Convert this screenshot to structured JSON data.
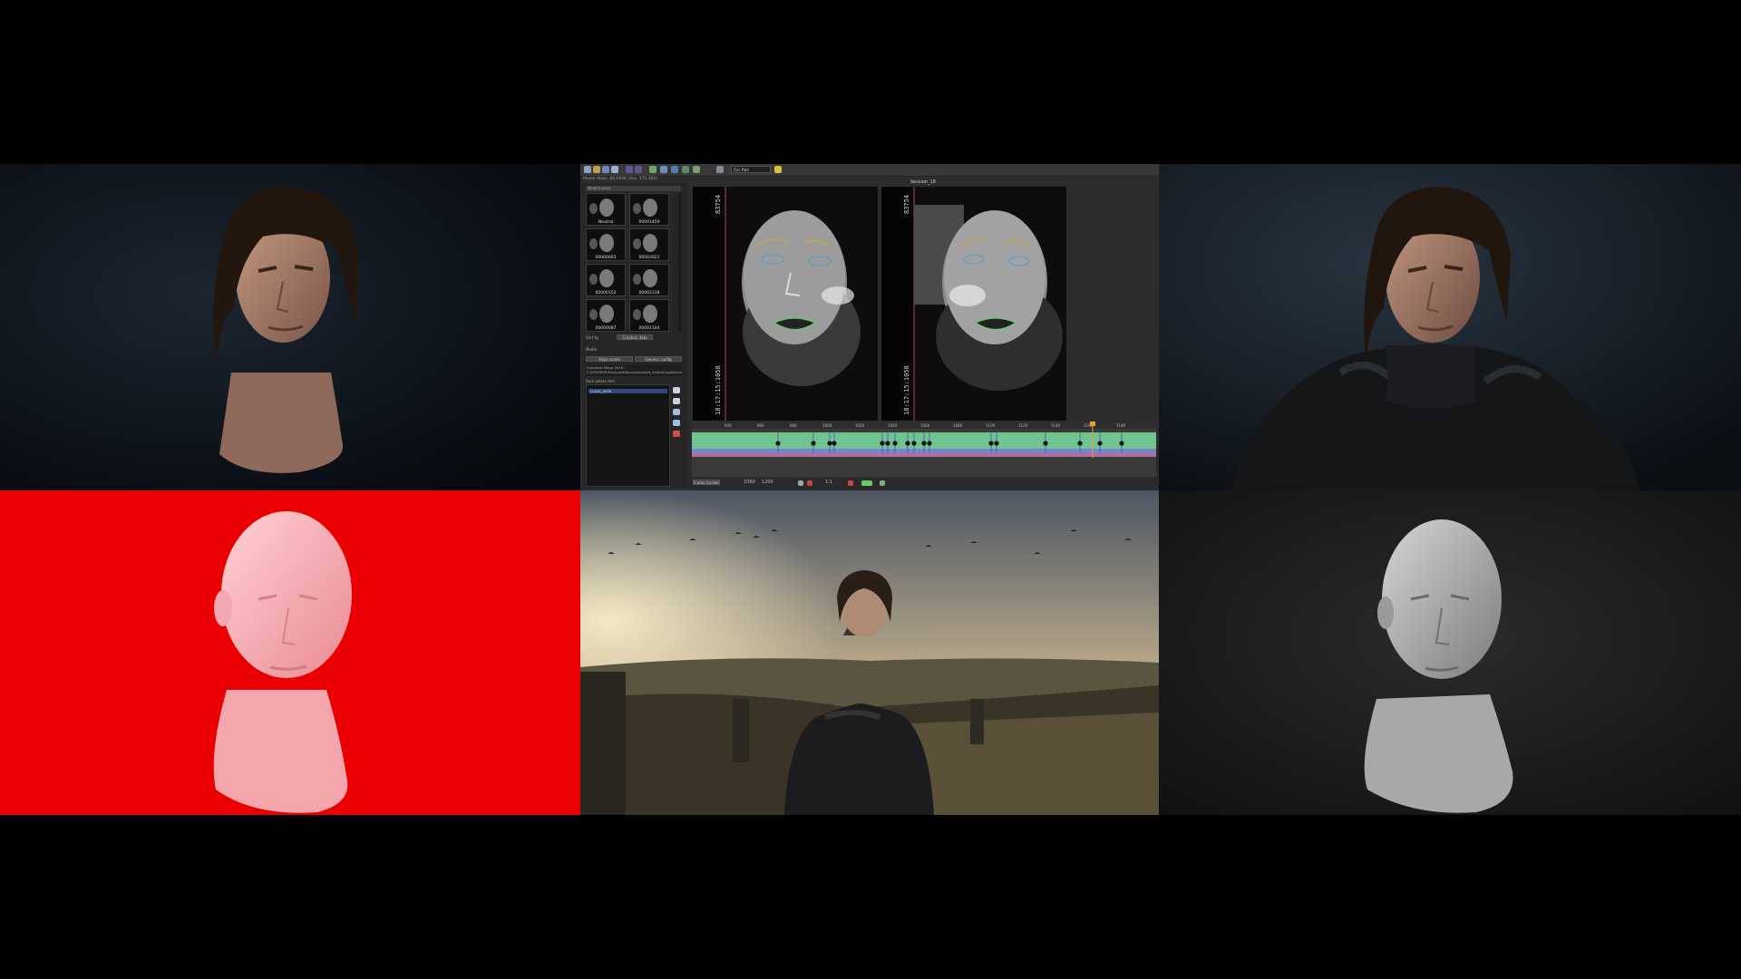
{
  "ui": {
    "toolbar": {
      "combo_value": "Go Pas"
    },
    "info_text": "Model Stats: 86,094K (Vtx: 170,360)",
    "session_title": "Session_18",
    "pane_header": "Neutral pose",
    "thumbnails": [
      {
        "label": "Neutral"
      },
      {
        "label": "00001459"
      },
      {
        "label": "00000003"
      },
      {
        "label": "00003921"
      },
      {
        "label": "00000152"
      },
      {
        "label": "00002318"
      },
      {
        "label": "00000087"
      },
      {
        "label": "00001104"
      }
    ],
    "sort_label": "Sort by",
    "sort_value": "Creation date",
    "section_label": "Model",
    "btn_left": "Align model",
    "btn_right": "Generic config",
    "path_text": "Autodesk Maya 2018 - C:/STARKER/Faces/set/faces/selected_neutral/rig/female_neutral_poses.ma",
    "list_header": "Face actors rem",
    "list_item": "Lucas_anim",
    "viewer_left": {
      "top_tc": "83754",
      "bottom_tc": "18:17:15:1058"
    },
    "viewer_right": {
      "top_tc": "83754",
      "bottom_tc": "18:17:15:1058"
    },
    "ruler_ticks": [
      "940",
      "960",
      "980",
      "1000",
      "1020",
      "1040",
      "1060",
      "1080",
      "1100",
      "1120",
      "1140",
      "1160",
      "1180",
      "1200",
      "1220"
    ],
    "bottom_mode": "Frame tracker",
    "frame_current": "1060",
    "frame_end": "1200",
    "counter": "1:1"
  }
}
